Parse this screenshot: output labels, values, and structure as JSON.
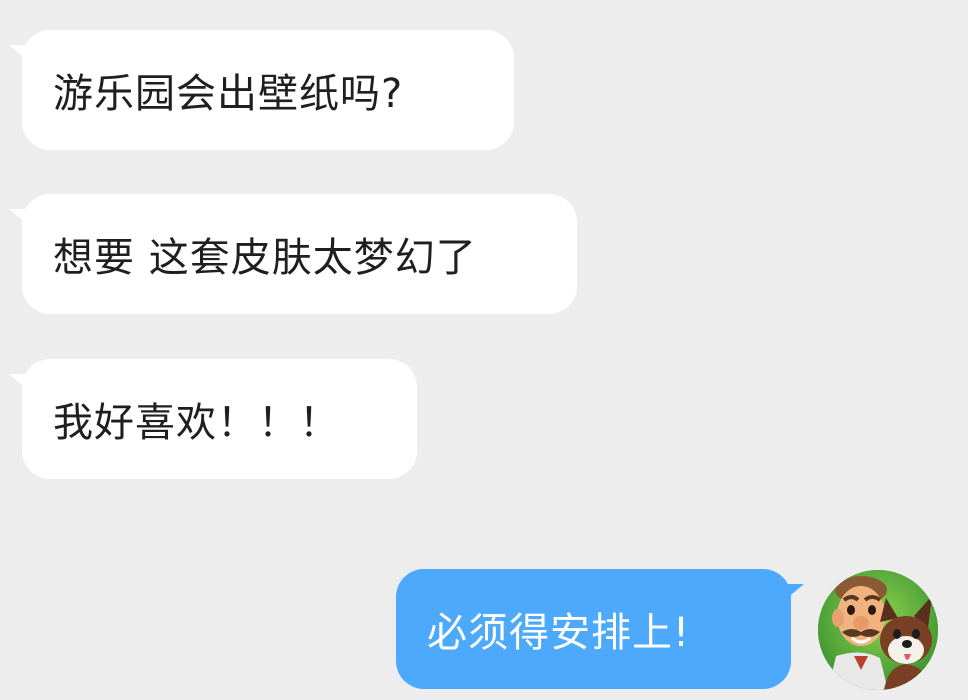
{
  "messages": [
    {
      "side": "left",
      "text": "游乐园会出壁纸吗?"
    },
    {
      "side": "left",
      "text": "想要 这套皮肤太梦幻了"
    },
    {
      "side": "left",
      "text": "我好喜欢！！！"
    },
    {
      "side": "right",
      "text": "必须得安排上!"
    }
  ],
  "avatar": {
    "icon": "avatar-man-and-dog-icon"
  },
  "colors": {
    "background": "#ededed",
    "incoming_bubble": "#ffffff",
    "outgoing_bubble": "#4ca9fb",
    "incoming_text": "#1f1f1f",
    "outgoing_text": "#ffffff"
  }
}
